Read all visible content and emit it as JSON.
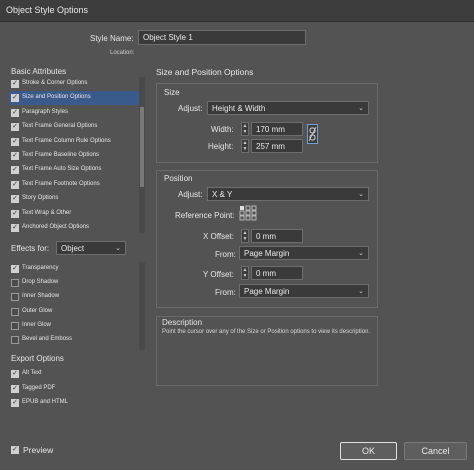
{
  "window": {
    "title": "Object Style Options"
  },
  "style_name": {
    "label": "Style Name:",
    "value": "Object Style 1"
  },
  "location_label": "Location:",
  "basic_attributes": {
    "header": "Basic Attributes",
    "items": [
      {
        "label": "Stroke & Corner Options",
        "checked": true
      },
      {
        "label": "Size and Position Options",
        "checked": true,
        "selected": true
      },
      {
        "label": "Paragraph Styles",
        "checked": true
      },
      {
        "label": "Text Frame General Options",
        "checked": true
      },
      {
        "label": "Text Frame Column Rule Options",
        "checked": true
      },
      {
        "label": "Text Frame Baseline Options",
        "checked": true
      },
      {
        "label": "Text Frame Auto Size Options",
        "checked": true
      },
      {
        "label": "Text Frame Footnote Options",
        "checked": true
      },
      {
        "label": "Story Options",
        "checked": true
      },
      {
        "label": "Text Wrap & Other",
        "checked": true
      },
      {
        "label": "Anchored Object Options",
        "checked": true
      }
    ]
  },
  "effects": {
    "label": "Effects for:",
    "target": "Object",
    "items": [
      {
        "label": "Transparency",
        "checked": true
      },
      {
        "label": "Drop Shadow",
        "checked": false
      },
      {
        "label": "Inner Shadow",
        "checked": false
      },
      {
        "label": "Outer Glow",
        "checked": false
      },
      {
        "label": "Inner Glow",
        "checked": false
      },
      {
        "label": "Bevel and Emboss",
        "checked": false
      }
    ]
  },
  "export_options": {
    "header": "Export Options",
    "items": [
      {
        "label": "Alt Text",
        "checked": true
      },
      {
        "label": "Tagged PDF",
        "checked": true
      },
      {
        "label": "EPUB and HTML",
        "checked": true
      }
    ]
  },
  "section_title": "Size and Position Options",
  "size": {
    "header": "Size",
    "adjust_label": "Adjust:",
    "adjust_value": "Height & Width",
    "width_label": "Width:",
    "width_value": "170 mm",
    "height_label": "Height:",
    "height_value": "257 mm"
  },
  "position": {
    "header": "Position",
    "adjust_label": "Adjust:",
    "adjust_value": "X & Y",
    "reference_label": "Reference Point:",
    "x_offset_label": "X Offset:",
    "x_offset_value": "0 mm",
    "x_from_label": "From:",
    "x_from_value": "Page Margin",
    "y_offset_label": "Y Offset:",
    "y_offset_value": "0 mm",
    "y_from_label": "From:",
    "y_from_value": "Page Margin"
  },
  "description": {
    "header": "Description",
    "text": "Point the cursor over any of the Size or Position options to view its description."
  },
  "preview": {
    "label": "Preview",
    "checked": true
  },
  "buttons": {
    "ok": "OK",
    "cancel": "Cancel"
  },
  "colors": {
    "accent": "#3a5a8c",
    "background": "#535353",
    "field": "#3a3a3a"
  }
}
